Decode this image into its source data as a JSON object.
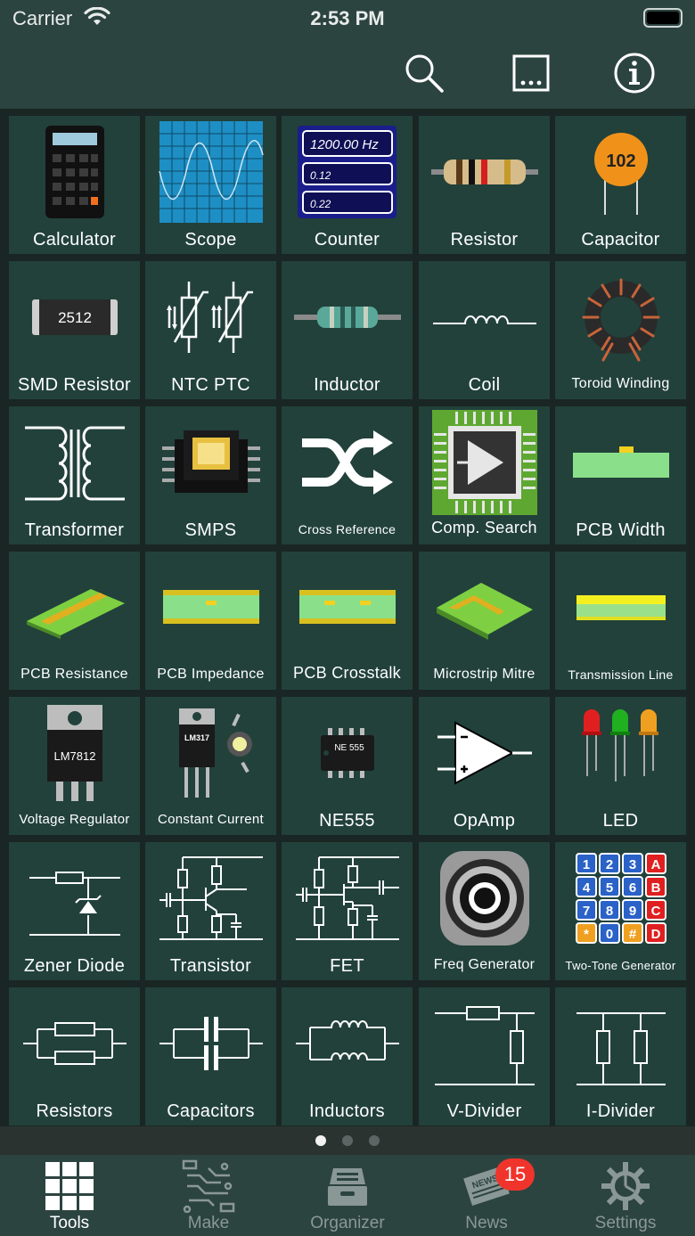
{
  "status": {
    "carrier": "Carrier",
    "time": "2:53 PM"
  },
  "toolbar": {
    "search_icon": "search-icon",
    "more_icon": "ellipsis-icon",
    "info_icon": "info-icon"
  },
  "art_text": {
    "counter_freq": "1200.00 Hz",
    "counter_a": "0.12",
    "counter_b": "0.22",
    "capacitor_code": "102",
    "smd_code": "2512",
    "regulator_code": "LM7812",
    "constant_code": "LM317",
    "ne555_code": "NE 555",
    "keypad": [
      "1",
      "2",
      "3",
      "A",
      "4",
      "5",
      "6",
      "B",
      "7",
      "8",
      "9",
      "C",
      "*",
      "0",
      "#",
      "D"
    ]
  },
  "tiles": [
    {
      "label": "Calculator"
    },
    {
      "label": "Scope"
    },
    {
      "label": "Counter"
    },
    {
      "label": "Resistor"
    },
    {
      "label": "Capacitor"
    },
    {
      "label": "SMD Resistor"
    },
    {
      "label": "NTC PTC"
    },
    {
      "label": "Inductor"
    },
    {
      "label": "Coil"
    },
    {
      "label": "Toroid Winding"
    },
    {
      "label": "Transformer"
    },
    {
      "label": "SMPS"
    },
    {
      "label": "Cross Reference"
    },
    {
      "label": "Comp. Search"
    },
    {
      "label": "PCB Width"
    },
    {
      "label": "PCB Resistance"
    },
    {
      "label": "PCB Impedance"
    },
    {
      "label": "PCB Crosstalk"
    },
    {
      "label": "Microstrip Mitre"
    },
    {
      "label": "Transmission Line"
    },
    {
      "label": "Voltage Regulator"
    },
    {
      "label": "Constant Current"
    },
    {
      "label": "NE555"
    },
    {
      "label": "OpAmp"
    },
    {
      "label": "LED"
    },
    {
      "label": "Zener Diode"
    },
    {
      "label": "Transistor"
    },
    {
      "label": "FET"
    },
    {
      "label": "Freq Generator"
    },
    {
      "label": "Two-Tone Generator"
    },
    {
      "label": "Resistors"
    },
    {
      "label": "Capacitors"
    },
    {
      "label": "Inductors"
    },
    {
      "label": "V-Divider"
    },
    {
      "label": "I-Divider"
    }
  ],
  "pager": {
    "pages": 3,
    "current": 1
  },
  "tabs": [
    {
      "label": "Tools",
      "active": true
    },
    {
      "label": "Make",
      "active": false
    },
    {
      "label": "Organizer",
      "active": false
    },
    {
      "label": "News",
      "active": false,
      "badge": "15"
    },
    {
      "label": "Settings",
      "active": false
    }
  ]
}
